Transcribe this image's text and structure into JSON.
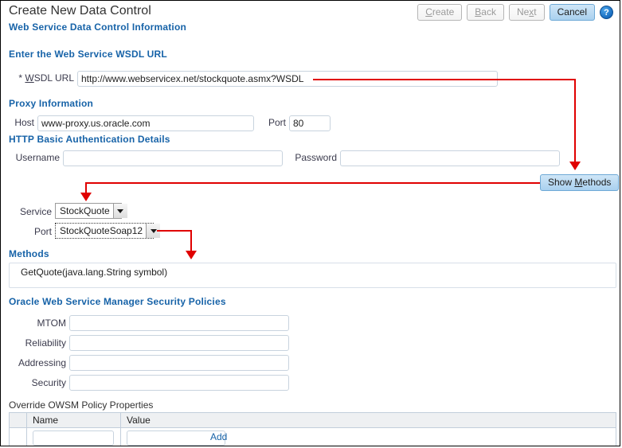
{
  "window": {
    "title": "Create New Data Control",
    "subtitle": "Web Service Data Control Information"
  },
  "toolbar": {
    "buttons": [
      {
        "label": "Create",
        "mnemonic": "C",
        "state": "disabled"
      },
      {
        "label": "Back",
        "mnemonic": "B",
        "state": "disabled"
      },
      {
        "label": "Next",
        "mnemonic": "x",
        "state": "disabled"
      },
      {
        "label": "Cancel",
        "mnemonic": "",
        "state": "focused"
      }
    ],
    "help_icon_glyph": "?"
  },
  "sections": {
    "wsdl": {
      "heading": "Enter the Web Service WSDL URL",
      "required_marker": "*",
      "url_label": "WSDL URL",
      "url_value": "http://www.webservicex.net/stockquote.asmx?WSDL",
      "url_placeholder": ""
    },
    "proxy": {
      "heading": "Proxy Information",
      "host_label": "Host",
      "host_value": "www-proxy.us.oracle.com",
      "port_label": "Port",
      "port_value": "80"
    },
    "auth": {
      "heading": "HTTP Basic Authentication Details",
      "username_label": "Username",
      "username_value": "",
      "password_label": "Password",
      "password_value": ""
    },
    "discovery": {
      "show_methods_label": "Show Methods",
      "show_methods_mnemonic": "M",
      "service_label": "Service",
      "service_value": "StockQuote",
      "port_label": "Port",
      "port_value": "StockQuoteSoap12"
    },
    "methods": {
      "heading": "Methods",
      "items": [
        "GetQuote(java.lang.String symbol)"
      ]
    },
    "owsm": {
      "heading": "Oracle Web Service Manager Security Policies",
      "fields": [
        {
          "label": "MTOM",
          "value": ""
        },
        {
          "label": "Reliability",
          "value": ""
        },
        {
          "label": "Addressing",
          "value": ""
        },
        {
          "label": "Security",
          "value": ""
        }
      ]
    },
    "override": {
      "heading": "Override OWSM Policy Properties",
      "columns": [
        "Name",
        "Value"
      ],
      "rows": [
        {
          "name": "",
          "value": ""
        }
      ],
      "add_label": "Add"
    }
  },
  "colors": {
    "heading_blue": "#1763a8",
    "annotation_red": "#e00000",
    "focused_button_blue": "#a9d0ef",
    "field_border": "#c8d3de"
  }
}
